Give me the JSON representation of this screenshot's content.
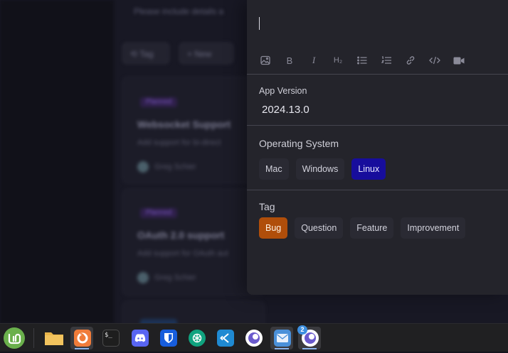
{
  "background_app": {
    "hint_text": "Please include details a",
    "tag_button": "Tag",
    "new_button": "New",
    "cards": [
      {
        "badge": "Planned",
        "title": "Websocket Support",
        "description": "Add support for bi-direct",
        "author": "Greg Schier"
      },
      {
        "badge": "Planned",
        "title": "OAuth 2.0 support",
        "description": "Add support for OAuth aut",
        "author": "Greg Schier"
      }
    ]
  },
  "editor": {
    "toolbar": {
      "image": "image-icon",
      "bold": "B",
      "italic": "I",
      "heading": "H₂",
      "bullet_list": "bullet-list-icon",
      "ordered_list": "numbered-list-icon",
      "link": "link-icon",
      "code": "code-icon",
      "video": "video-icon"
    },
    "app_version": {
      "label": "App Version",
      "value": "2024.13.0"
    },
    "operating_system": {
      "label": "Operating System",
      "options": [
        "Mac",
        "Windows",
        "Linux"
      ],
      "selected": "Linux"
    },
    "tag": {
      "label": "Tag",
      "options": [
        "Bug",
        "Question",
        "Feature",
        "Improvement"
      ],
      "selected": "Bug"
    },
    "colors": {
      "os_selected": "#170d9c",
      "tag_selected": "#b04e0a",
      "panel": "#24242b"
    }
  },
  "taskbar": {
    "items": [
      {
        "name": "linux-mint-menu-icon",
        "color": "#6ab04c"
      },
      {
        "name": "files-folder-icon",
        "color": "#e8b54a"
      },
      {
        "name": "firefox-icon",
        "color": "#f07c3a"
      },
      {
        "name": "terminal-icon",
        "color": "#1e1e1e"
      },
      {
        "name": "discord-icon",
        "color": "#5865f2"
      },
      {
        "name": "bitwarden-icon",
        "color": "#175ddc"
      },
      {
        "name": "chatgpt-icon",
        "color": "#10a37f"
      },
      {
        "name": "vscode-icon",
        "color": "#1f8ad2"
      },
      {
        "name": "insomnia-icon",
        "color": "#6a5acd"
      },
      {
        "name": "mail-icon",
        "color": "#4a90d9"
      },
      {
        "name": "insomnia-icon-2",
        "color": "#6a5acd"
      }
    ],
    "notification_count": "2",
    "terminal_glyph": "$_"
  }
}
